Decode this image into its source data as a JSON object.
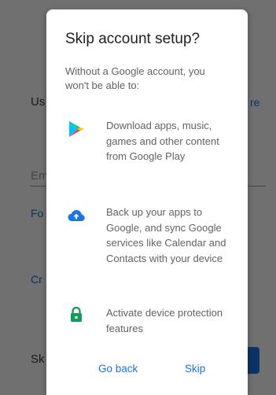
{
  "background": {
    "label_left": "Us",
    "link_right": "re",
    "field_hint": "Em",
    "link_forgot": "Fo",
    "link_create": "Cr",
    "skip_left": "Sk"
  },
  "dialog": {
    "title": "Skip account setup?",
    "subtitle": "Without a Google account, you won't be able to:",
    "items": [
      {
        "icon": "google-play-icon",
        "text": "Download apps, music, games and other content from Google Play"
      },
      {
        "icon": "cloud-upload-icon",
        "text": "Back up your apps to Google, and sync Google services like Calendar and Contacts with your device"
      },
      {
        "icon": "lock-icon",
        "text": "Activate device protection features"
      }
    ],
    "go_back_label": "Go back",
    "skip_label": "Skip"
  },
  "colors": {
    "accent": "#1a73e8",
    "lock_green": "#0f9d58"
  }
}
